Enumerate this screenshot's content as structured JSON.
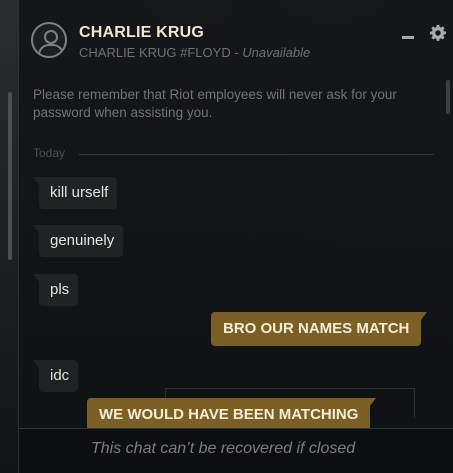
{
  "contact": {
    "name": "CHARLIE KRUG",
    "tag": "CHARLIE KRUG #FLOYD",
    "separator": "-",
    "status": "Unavailable"
  },
  "header_icons": [
    "avatar-icon",
    "minimize-icon",
    "gear-icon"
  ],
  "warning": "Please remember that Riot employees will never ask for your password when assisting you.",
  "divider_label": "Today",
  "messages": [
    {
      "direction": "incoming",
      "text": "kill urself"
    },
    {
      "direction": "incoming",
      "text": "genuinely"
    },
    {
      "direction": "incoming",
      "text": "pls"
    },
    {
      "direction": "outgoing",
      "text": "BRO OUR NAMES MATCH"
    },
    {
      "direction": "incoming",
      "text": "idc"
    },
    {
      "direction": "outgoing",
      "text": "WE WOULD HAVE BEEN MATCHING"
    }
  ],
  "footer_notice": "This chat can’t be recovered if closed",
  "colors": {
    "outgoing_bubble": "#7b5f25",
    "incoming_bubble": "#1f2326",
    "name_text": "#f0e6d2",
    "panel_bg": "#14171a"
  }
}
